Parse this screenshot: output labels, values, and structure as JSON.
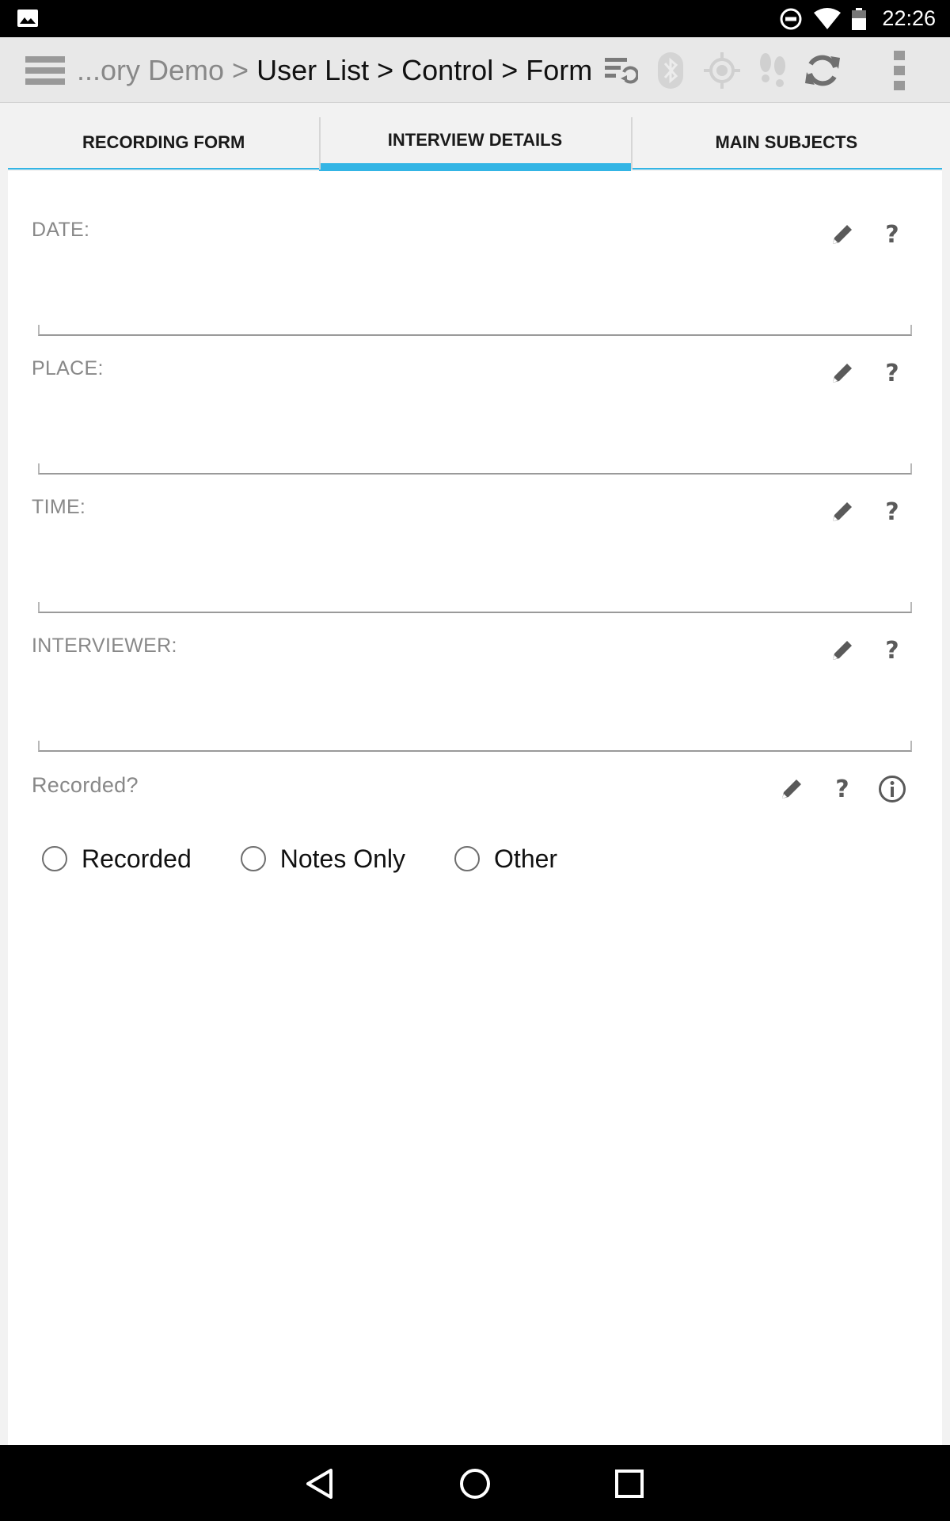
{
  "status_bar": {
    "time": "22:26",
    "icons": [
      "gallery-notification-icon",
      "do-not-disturb-icon",
      "wifi-icon",
      "battery-icon"
    ]
  },
  "action_bar": {
    "breadcrumb_prefix": "...ory Demo >",
    "breadcrumb_main": "User List > Control > Form",
    "icons": [
      "menu-icon",
      "sync-list-icon",
      "bluetooth-icon",
      "gps-icon",
      "footsteps-icon",
      "refresh-icon",
      "overflow-menu-icon"
    ]
  },
  "tabs": [
    {
      "label": "RECORDING FORM",
      "active": false
    },
    {
      "label": "INTERVIEW DETAILS",
      "active": true
    },
    {
      "label": "MAIN SUBJECTS",
      "active": false
    }
  ],
  "accent_color": "#33b5e5",
  "form": {
    "fields": [
      {
        "label": "DATE:",
        "value": ""
      },
      {
        "label": "PLACE:",
        "value": ""
      },
      {
        "label": "TIME:",
        "value": ""
      },
      {
        "label": "INTERVIEWER:",
        "value": ""
      }
    ],
    "question": {
      "label": "Recorded?",
      "options": [
        "Recorded",
        "Notes Only",
        "Other"
      ],
      "selected": null
    },
    "help_symbol": "?"
  },
  "nav_bar": {
    "icons": [
      "back-icon",
      "home-icon",
      "recents-icon"
    ]
  }
}
